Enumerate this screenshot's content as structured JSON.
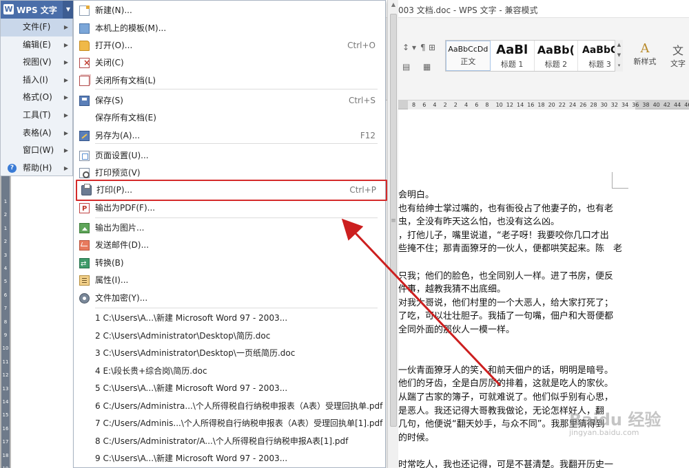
{
  "window": {
    "title": "003 文档.doc - WPS 文字 - 兼容模式"
  },
  "app_menu": {
    "brand": "WPS 文字",
    "items": [
      {
        "label": "文件(F)",
        "active": true,
        "submenu": true
      },
      {
        "label": "编辑(E)",
        "active": false,
        "submenu": true
      },
      {
        "label": "视图(V)",
        "active": false,
        "submenu": true
      },
      {
        "label": "插入(I)",
        "active": false,
        "submenu": true
      },
      {
        "label": "格式(O)",
        "active": false,
        "submenu": true
      },
      {
        "label": "工具(T)",
        "active": false,
        "submenu": true
      },
      {
        "label": "表格(A)",
        "active": false,
        "submenu": true
      },
      {
        "label": "窗口(W)",
        "active": false,
        "submenu": true
      },
      {
        "label": "帮助(H)",
        "active": false,
        "submenu": true,
        "icon": "help-icon"
      }
    ]
  },
  "file_menu": {
    "items": [
      {
        "label": "新建(N)...",
        "shortcut": "",
        "icon": "new-doc-icon"
      },
      {
        "label": "本机上的模板(M)...",
        "shortcut": "",
        "icon": "template-icon"
      },
      {
        "label": "打开(O)...",
        "shortcut": "Ctrl+O",
        "icon": "folder-open-icon"
      },
      {
        "label": "关闭(C)",
        "shortcut": "",
        "icon": "close-doc-icon"
      },
      {
        "label": "关闭所有文档(L)",
        "shortcut": "",
        "icon": "close-all-icon"
      },
      {
        "label": "保存(S)",
        "shortcut": "Ctrl+S",
        "icon": "save-icon"
      },
      {
        "label": "保存所有文档(E)",
        "shortcut": "",
        "icon": ""
      },
      {
        "label": "另存为(A)...",
        "shortcut": "F12",
        "icon": "save-as-icon"
      },
      {
        "label": "页面设置(U)...",
        "shortcut": "",
        "icon": "page-setup-icon"
      },
      {
        "label": "打印预览(V)",
        "shortcut": "",
        "icon": "print-preview-icon"
      },
      {
        "label": "打印(P)...",
        "shortcut": "Ctrl+P",
        "icon": "print-icon",
        "highlighted": true
      },
      {
        "label": "输出为PDF(F)...",
        "shortcut": "",
        "icon": "pdf-icon"
      },
      {
        "label": "输出为图片...",
        "shortcut": "",
        "icon": "image-export-icon"
      },
      {
        "label": "发送邮件(D)...",
        "shortcut": "",
        "icon": "mail-icon"
      },
      {
        "label": "转换(B)",
        "shortcut": "",
        "icon": "convert-icon"
      },
      {
        "label": "属性(I)...",
        "shortcut": "",
        "icon": "properties-icon"
      },
      {
        "label": "文件加密(Y)...",
        "shortcut": "",
        "icon": "encrypt-icon"
      }
    ],
    "recent_files": [
      "1 C:\\Users\\A...\\新建 Microsoft Word 97 - 2003...",
      "2 C:\\Users\\Administrator\\Desktop\\简历.doc",
      "3 C:\\Users\\Administrator\\Desktop\\一页纸简历.doc",
      "4 E:\\段长贵+综合岗\\简历.doc",
      "5 C:\\Users\\A...\\新建 Microsoft Word 97 - 2003...",
      "6 C:/Users/Administra...\\个人所得税自行纳税申报表（A表）受理回执单.pdf",
      "7 C:/Users/Adminis...\\个人所得税自行纳税申报表（A表）受理回执单[1].pdf",
      "8 C:/Users/Administrator/A...\\个人所得税自行纳税申报A表[1].pdf",
      "9 C:\\Users\\A...\\新建 Microsoft Word 97 - 2003..."
    ]
  },
  "ribbon": {
    "styles": [
      {
        "sample": "AaBbCcDd",
        "name": "正文"
      },
      {
        "sample": "AaBl",
        "name": "标题 1"
      },
      {
        "sample": "AaBb(",
        "name": "标题 2"
      },
      {
        "sample": "AaBbC",
        "name": "标题 3"
      }
    ],
    "new_style_label": "新样式",
    "text_tool_label": "文字"
  },
  "ruler": {
    "h_ticks": [
      "8",
      "6",
      "4",
      "2",
      "2",
      "4",
      "6",
      "8",
      "10",
      "12",
      "14",
      "16",
      "18",
      "20",
      "22",
      "24",
      "26",
      "28",
      "30",
      "32",
      "34",
      "36",
      "38",
      "40",
      "42",
      "44",
      "46"
    ],
    "v_ticks": [
      "1",
      "2",
      "1",
      "2",
      "3",
      "4",
      "5",
      "6",
      "7",
      "8",
      "9",
      "10",
      "11",
      "12",
      "13",
      "14",
      "15",
      "16",
      "17",
      "18",
      "19",
      "20"
    ]
  },
  "document": {
    "lines": [
      "会明白。",
      "也有给绅士掌过嘴的，也有衙役占了他妻子的，也有老",
      "虫，全没有昨天这么怕，也没有这么凶。",
      "，打他儿子，嘴里说道，“老子呀！我要咬你几口才出",
      "些掩不住；那青面獠牙的一伙人，便都哄笑起来。陈　老",
      "",
      "只我；他们的脸色，也全同别人一样。进了书房，便反",
      "件事，越教我猜不出底细。",
      "对我大哥说，他们村里的一个大恶人，给大家打死了；",
      "了吃，可以壮壮胆子。我插了一句嘴，佃户和大哥便都",
      "全同外面的那伙人一模一样。",
      "",
      "",
      "一伙青面獠牙人的笑，和前天佃户的话，明明是暗号。",
      "他们的牙齿，全是白厉厉的排着，这就是吃人的家伙。",
      "从踹了古家的簿子，可就难说了。他们似乎别有心思，",
      "是恶人。我还记得大哥教我做论，无论怎样好人，翻",
      "几句，他便说“翻天妙手，与众不同”。我那里猜得到",
      "的时候。",
      "",
      "时常吃人，我也还记得，可是不甚清楚。我翻开历史一"
    ]
  },
  "watermark": {
    "text": "Baidu 经验",
    "sub": "jingyan.baidu.com"
  },
  "colors": {
    "highlight_box": "#d42a2a",
    "arrow": "#cc1f1f",
    "brand": "#4a6ea9"
  }
}
